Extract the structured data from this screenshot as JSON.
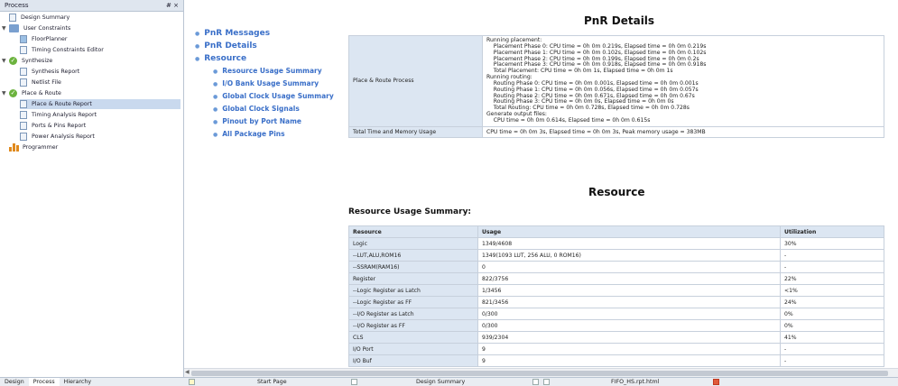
{
  "process_panel": {
    "title": "Process",
    "pin": "# ×",
    "items": [
      {
        "label": "Design Summary",
        "icon": "doc-icon"
      },
      {
        "label": "User Constraints",
        "icon": "folder-icon"
      },
      {
        "label": "FloorPlanner",
        "icon": "floorplanner-icon"
      },
      {
        "label": "Timing Constraints Editor",
        "icon": "doc-icon"
      },
      {
        "label": "Synthesize",
        "icon": "check-icon"
      },
      {
        "label": "Synthesis Report",
        "icon": "doc-icon"
      },
      {
        "label": "Netlist File",
        "icon": "doc-icon"
      },
      {
        "label": "Place & Route",
        "icon": "check-icon"
      },
      {
        "label": "Place & Route Report",
        "icon": "doc-icon"
      },
      {
        "label": "Timing Analysis Report",
        "icon": "doc-icon"
      },
      {
        "label": "Ports & Pins Report",
        "icon": "doc-icon"
      },
      {
        "label": "Power Analysis Report",
        "icon": "doc-icon"
      },
      {
        "label": "Programmer",
        "icon": "programmer-icon"
      }
    ],
    "tabs": [
      "Design",
      "Process",
      "Hierarchy"
    ]
  },
  "doc_tabs": [
    "Start Page",
    "Design Summary",
    "FIFO_HS.rpt.html"
  ],
  "nav": {
    "pnr_messages": "PnR Messages",
    "pnr_details": "PnR Details",
    "resource": "Resource",
    "sub": [
      "Resource Usage Summary",
      "I/O Bank Usage Summary",
      "Global Clock Usage Summary",
      "Global Clock Signals",
      "Pinout by Port Name",
      "All Package Pins"
    ]
  },
  "pnr": {
    "title": "PnR Details",
    "row1_key": "Place & Route Process",
    "row1_value": "Running placement:\n    Placement Phase 0: CPU time = 0h 0m 0.219s, Elapsed time = 0h 0m 0.219s\n    Placement Phase 1: CPU time = 0h 0m 0.102s, Elapsed time = 0h 0m 0.102s\n    Placement Phase 2: CPU time = 0h 0m 0.199s, Elapsed time = 0h 0m 0.2s\n    Placement Phase 3: CPU time = 0h 0m 0.918s, Elapsed time = 0h 0m 0.918s\n    Total Placement: CPU time = 0h 0m 1s, Elapsed time = 0h 0m 1s\nRunning routing:\n    Routing Phase 0: CPU time = 0h 0m 0.001s, Elapsed time = 0h 0m 0.001s\n    Routing Phase 1: CPU time = 0h 0m 0.056s, Elapsed time = 0h 0m 0.057s\n    Routing Phase 2: CPU time = 0h 0m 0.671s, Elapsed time = 0h 0m 0.67s\n    Routing Phase 3: CPU time = 0h 0m 0s, Elapsed time = 0h 0m 0s\n    Total Routing: CPU time = 0h 0m 0.728s, Elapsed time = 0h 0m 0.728s\nGenerate output files:\n    CPU time = 0h 0m 0.614s, Elapsed time = 0h 0m 0.615s",
    "row2_key": "Total Time and Memory Usage",
    "row2_value": "CPU time = 0h 0m 3s, Elapsed time = 0h 0m 3s, Peak memory usage = 383MB"
  },
  "resource": {
    "title": "Resource",
    "subtitle": "Resource Usage Summary:",
    "headers": [
      "Resource",
      "Usage",
      "Utilization"
    ],
    "rows": [
      [
        "Logic",
        "1349/4608",
        "30%"
      ],
      [
        "--LUT,ALU,ROM16",
        "1349(1093 LUT, 256 ALU, 0 ROM16)",
        "-"
      ],
      [
        "--SSRAM(RAM16)",
        "0",
        "-"
      ],
      [
        "Register",
        "822/3756",
        "22%"
      ],
      [
        "--Logic Register as Latch",
        "1/3456",
        "<1%"
      ],
      [
        "--Logic Register as FF",
        "821/3456",
        "24%"
      ],
      [
        "--I/O Register as Latch",
        "0/300",
        "0%"
      ],
      [
        "--I/O Register as FF",
        "0/300",
        "0%"
      ],
      [
        "CLS",
        "939/2304",
        "41%"
      ],
      [
        "I/O Port",
        "9",
        "-"
      ],
      [
        "I/O Buf",
        "9",
        "-"
      ]
    ]
  }
}
